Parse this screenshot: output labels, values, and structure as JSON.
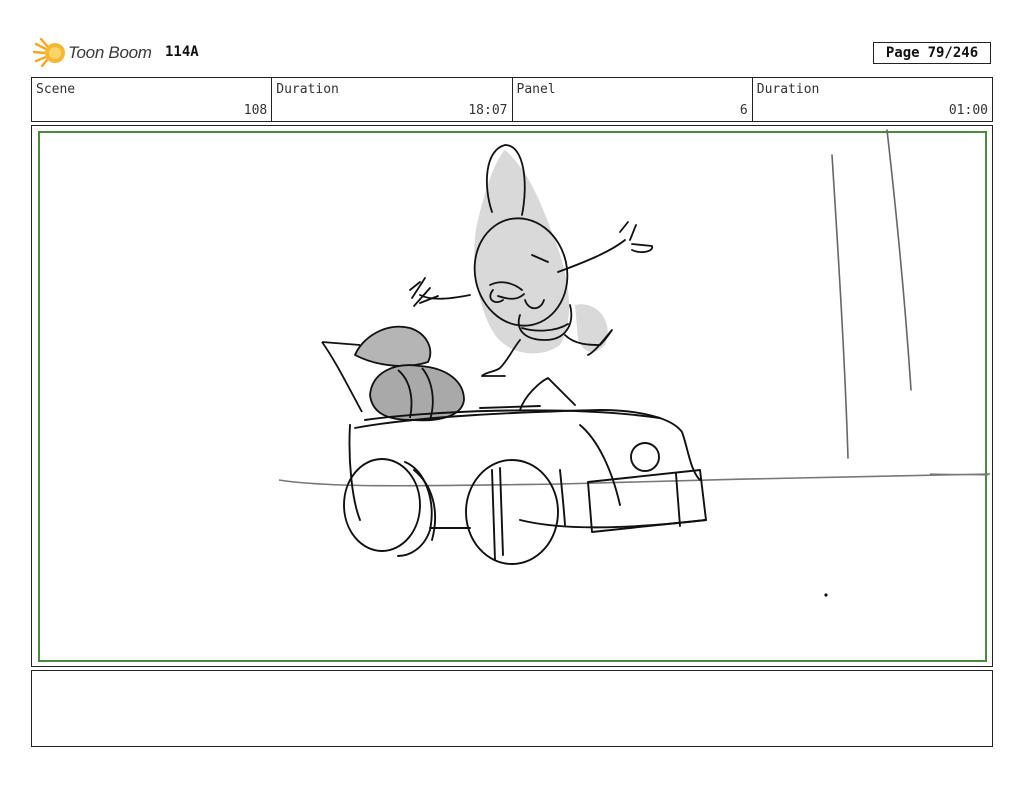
{
  "header": {
    "logo_text": "Toon Boom",
    "episode": "114A",
    "page_label": "Page",
    "page_number": "79/246"
  },
  "info": {
    "scene_label": "Scene",
    "scene_value": "108",
    "scene_duration_label": "Duration",
    "scene_duration_value": "18:07",
    "panel_label": "Panel",
    "panel_value": "6",
    "panel_duration_label": "Duration",
    "panel_duration_value": "01:00"
  },
  "colors": {
    "logo_orange": "#f5a623",
    "safe_frame_green": "#4a8a3c",
    "sketch_line": "#111111",
    "sketch_tone": "#d8d8d8"
  },
  "icons": [
    "toon-boom-logo-icon"
  ],
  "notes": ""
}
